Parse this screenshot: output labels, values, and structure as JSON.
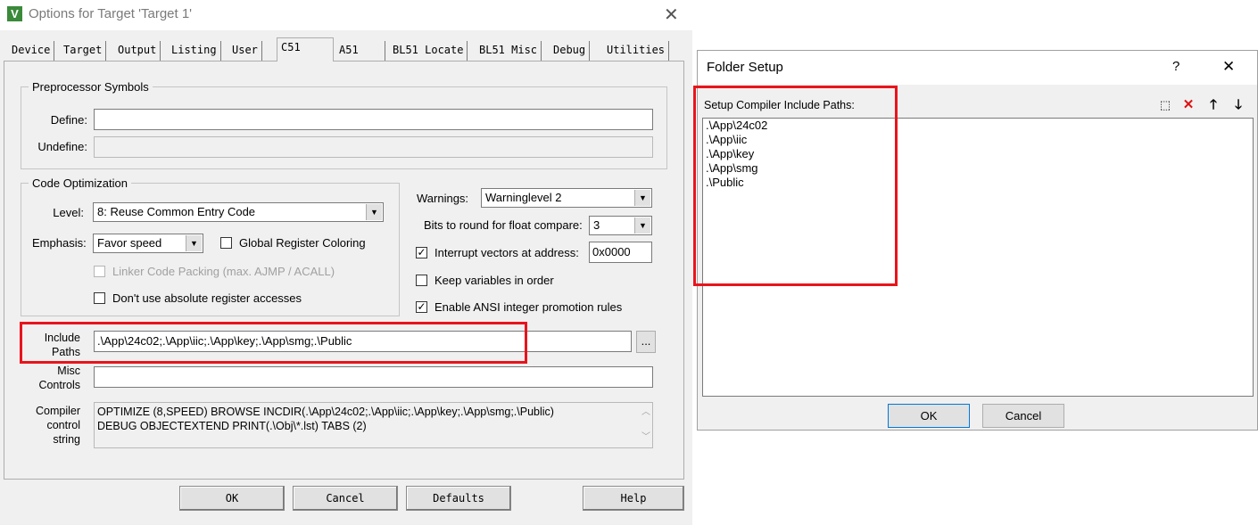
{
  "options_window": {
    "title": "Options for Target 'Target 1'",
    "app_icon_glyph": "V",
    "close_glyph": "✕",
    "tabs": [
      {
        "label": "Device"
      },
      {
        "label": "Target"
      },
      {
        "label": "Output"
      },
      {
        "label": "Listing"
      },
      {
        "label": "User"
      },
      {
        "label": "C51"
      },
      {
        "label": "A51"
      },
      {
        "label": "BL51 Locate"
      },
      {
        "label": "BL51 Misc"
      },
      {
        "label": "Debug"
      },
      {
        "label": "Utilities"
      }
    ],
    "active_tab": "C51",
    "preprocessor": {
      "legend": "Preprocessor Symbols",
      "define_label": "Define:",
      "define_value": "",
      "undefine_label": "Undefine:",
      "undefine_value": ""
    },
    "code_optimization": {
      "legend": "Code Optimization",
      "level_label": "Level:",
      "level_value": "8: Reuse Common Entry Code",
      "emphasis_label": "Emphasis:",
      "emphasis_value": "Favor speed",
      "global_register_coloring": "Global Register Coloring",
      "linker_code_packing": "Linker Code Packing (max. AJMP / ACALL)",
      "no_absolute_register": "Don't use absolute register accesses"
    },
    "right_options": {
      "warnings_label": "Warnings:",
      "warnings_value": "Warninglevel 2",
      "bits_label": "Bits to round for float compare:",
      "bits_value": "3",
      "interrupt_vectors_label": "Interrupt vectors at address:",
      "interrupt_vectors_value": "0x0000",
      "keep_variables_label": "Keep variables in order",
      "ansi_promotion_label": "Enable ANSI integer promotion rules"
    },
    "include_paths": {
      "label_line1": "Include",
      "label_line2": "Paths",
      "value": ".\\App\\24c02;.\\App\\iic;.\\App\\key;.\\App\\smg;.\\Public",
      "browse_label": "..."
    },
    "misc_controls": {
      "label_line1": "Misc",
      "label_line2": "Controls",
      "value": ""
    },
    "compiler_control": {
      "label_line1": "Compiler",
      "label_line2": "control",
      "label_line3": "string",
      "line1": "OPTIMIZE (8,SPEED) BROWSE INCDIR(.\\App\\24c02;.\\App\\iic;.\\App\\key;.\\App\\smg;.\\Public)",
      "line2": "DEBUG OBJECTEXTEND PRINT(.\\Obj\\*.lst) TABS (2)"
    },
    "buttons": {
      "ok": "OK",
      "cancel": "Cancel",
      "defaults": "Defaults",
      "help": "Help"
    }
  },
  "folder_setup": {
    "title": "Folder Setup",
    "help_glyph": "?",
    "close_glyph": "✕",
    "header_label": "Setup Compiler Include Paths:",
    "toolbar_icons": [
      "new-folder-icon",
      "delete-icon",
      "move-up-icon",
      "move-down-icon"
    ],
    "paths": [
      ".\\App\\24c02",
      ".\\App\\iic",
      ".\\App\\key",
      ".\\App\\smg",
      ".\\Public"
    ],
    "ok_label": "OK",
    "cancel_label": "Cancel"
  },
  "colors": {
    "highlight_box": "#e8141c",
    "window_bg": "#f0f0f0"
  }
}
